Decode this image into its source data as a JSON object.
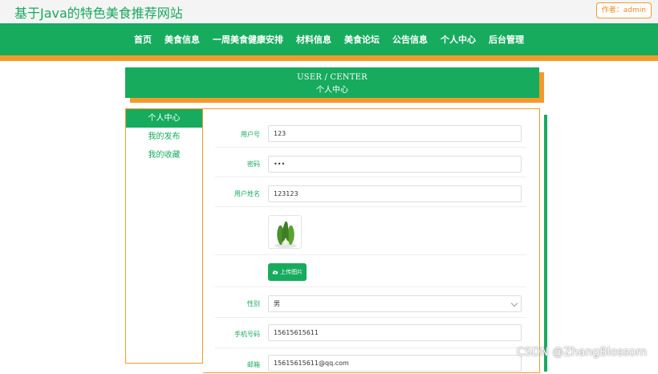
{
  "site": {
    "title": "基于Java的特色美食推荐网站",
    "author_label": "作者：admin"
  },
  "nav": {
    "items": [
      "首页",
      "美食信息",
      "一周美食健康安排",
      "材料信息",
      "美食论坛",
      "公告信息",
      "个人中心",
      "后台管理"
    ]
  },
  "header": {
    "english": "USER / CENTER",
    "chinese": "个人中心"
  },
  "sidebar": {
    "items": [
      "个人中心",
      "我的发布",
      "我的收藏"
    ],
    "active": "个人中心"
  },
  "form": {
    "username": {
      "label": "用户号",
      "value": "123"
    },
    "password": {
      "label": "密码",
      "value": "•••"
    },
    "name": {
      "label": "用户姓名",
      "value": "123123"
    },
    "upload_button": "上传图片",
    "gender": {
      "label": "性别",
      "value": "男"
    },
    "phone": {
      "label": "手机号码",
      "value": "15615615611"
    },
    "email": {
      "label": "邮箱",
      "value": "15615615611@qq.com"
    }
  },
  "watermark": "CSDN @ZhangBlossom",
  "colors": {
    "primary": "#17ab5e",
    "accent": "#f39a2b"
  },
  "icons": {
    "upload": "cloud-upload-icon",
    "caret": "chevron-down-icon"
  }
}
